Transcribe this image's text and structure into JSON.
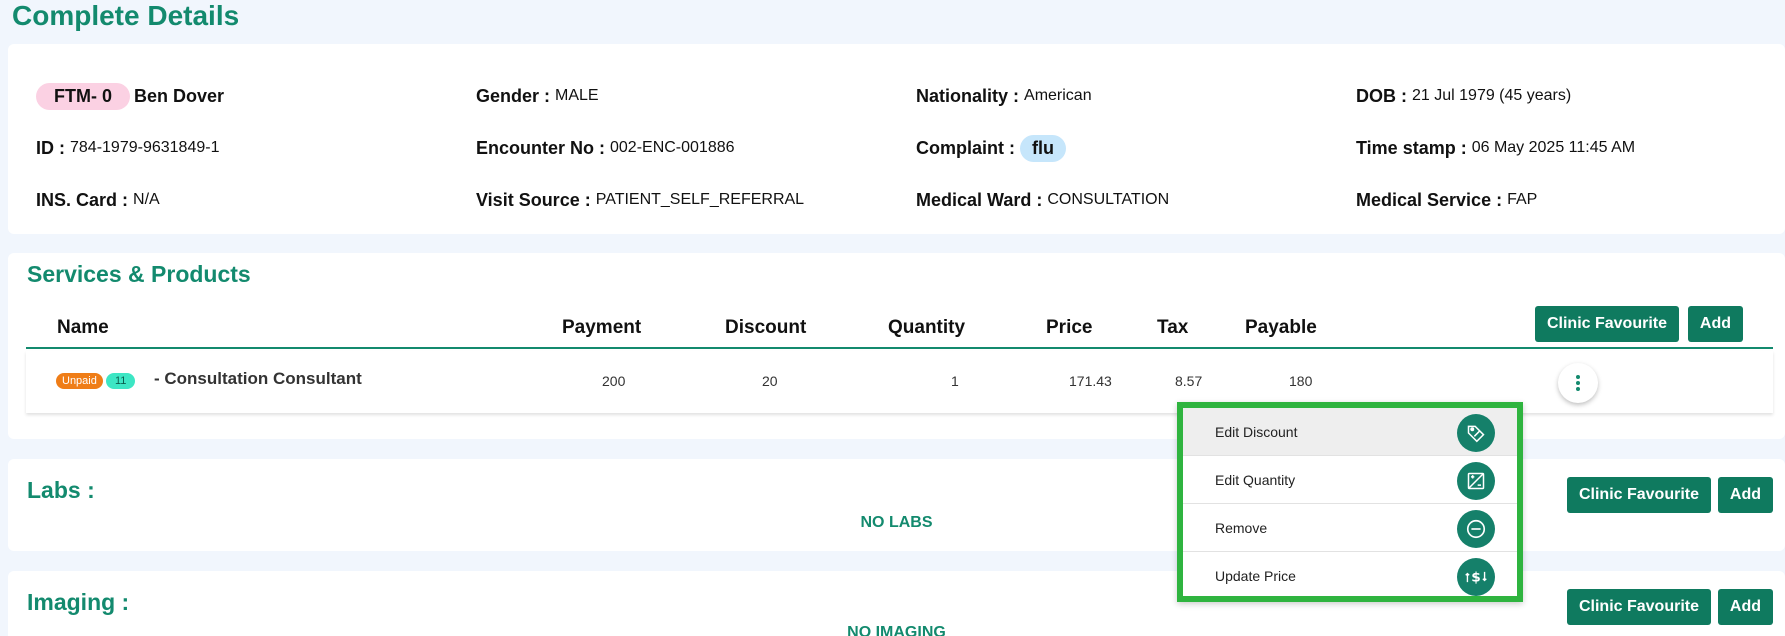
{
  "page_title": "Complete Details",
  "patient": {
    "tag": "FTM- 0",
    "name": "Ben Dover",
    "gender_label": "Gender :",
    "gender": "MALE",
    "nationality_label": "Nationality :",
    "nationality": "American",
    "dob_label": "DOB :",
    "dob": "21 Jul 1979 (45 years)",
    "id_label": "ID :",
    "id": "784-1979-9631849-1",
    "encounter_label": "Encounter No :",
    "encounter": "002-ENC-001886",
    "complaint_label": "Complaint :",
    "complaint": "flu",
    "timestamp_label": "Time stamp :",
    "timestamp": "06 May 2025 11:45 AM",
    "ins_label": "INS. Card :",
    "ins": "N/A",
    "visit_source_label": "Visit Source :",
    "visit_source": "PATIENT_SELF_REFERRAL",
    "ward_label": "Medical Ward :",
    "ward": "CONSULTATION",
    "service_label": "Medical Service :",
    "service": "FAP"
  },
  "services": {
    "title": "Services & Products",
    "clinic_fav_label": "Clinic Favourite",
    "add_label": "Add",
    "columns": [
      "Name",
      "Payment",
      "Discount",
      "Quantity",
      "Price",
      "Tax",
      "Payable"
    ],
    "rows": [
      {
        "status": "Unpaid",
        "badge": "11",
        "name": "- Consultation Consultant",
        "payment": "200",
        "discount": "20",
        "quantity": "1",
        "price": "171.43",
        "tax": "8.57",
        "payable": "180"
      }
    ]
  },
  "labs": {
    "title": "Labs :",
    "empty": "NO LABS",
    "clinic_fav_label": "Clinic Favourite",
    "add_label": "Add"
  },
  "imaging": {
    "title": "Imaging :",
    "empty": "NO IMAGING",
    "clinic_fav_label": "Clinic Favourite",
    "add_label": "Add"
  },
  "context_menu": {
    "items": [
      {
        "label": "Edit Discount",
        "icon": "discount-tag-icon"
      },
      {
        "label": "Edit Quantity",
        "icon": "quantity-icon"
      },
      {
        "label": "Remove",
        "icon": "minus-circle-icon"
      },
      {
        "label": "Update Price",
        "icon": "price-update-icon"
      }
    ]
  },
  "colors": {
    "brand": "#138a6e",
    "button": "#0f7a5f",
    "highlight_border": "#2fb43f",
    "unpaid": "#ef7d17",
    "badge": "#3de6c4"
  }
}
